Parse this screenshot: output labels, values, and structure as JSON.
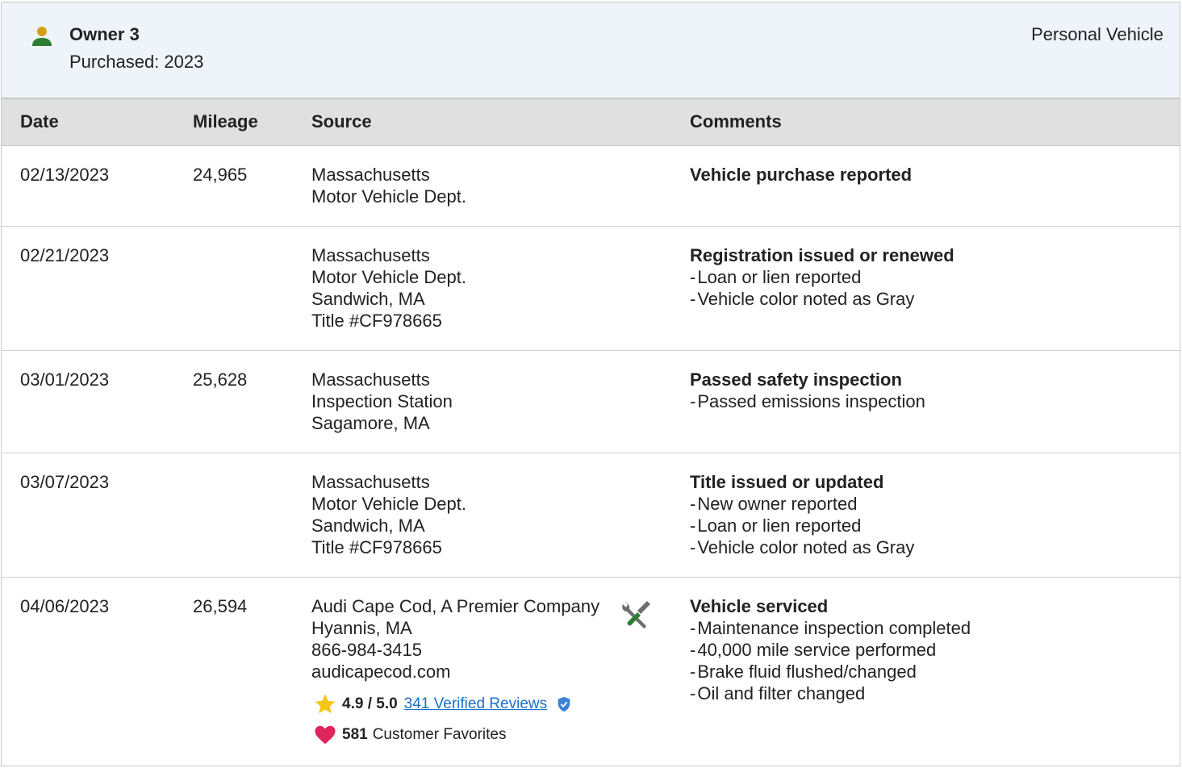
{
  "owner": {
    "title": "Owner 3",
    "purchased": "Purchased: 2023",
    "type": "Personal Vehicle",
    "icon": "person-icon"
  },
  "columns": {
    "date": "Date",
    "mileage": "Mileage",
    "source": "Source",
    "comments": "Comments"
  },
  "records": [
    {
      "date": "02/13/2023",
      "mileage": "24,965",
      "source": [
        "Massachusetts",
        "Motor Vehicle Dept."
      ],
      "comment_title": "Vehicle purchase reported",
      "comment_items": []
    },
    {
      "date": "02/21/2023",
      "mileage": "",
      "source": [
        "Massachusetts",
        "Motor Vehicle Dept.",
        "Sandwich, MA",
        "Title #CF978665"
      ],
      "comment_title": "Registration issued or renewed",
      "comment_items": [
        "Loan or lien reported",
        "Vehicle color noted as Gray"
      ]
    },
    {
      "date": "03/01/2023",
      "mileage": "25,628",
      "source": [
        "Massachusetts",
        "Inspection Station",
        "Sagamore, MA"
      ],
      "comment_title": "Passed safety inspection",
      "comment_items": [
        "Passed emissions inspection"
      ]
    },
    {
      "date": "03/07/2023",
      "mileage": "",
      "source": [
        "Massachusetts",
        "Motor Vehicle Dept.",
        "Sandwich, MA",
        "Title #CF978665"
      ],
      "comment_title": "Title issued or updated",
      "comment_items": [
        "New owner reported",
        "Loan or lien reported",
        "Vehicle color noted as Gray"
      ]
    },
    {
      "date": "04/06/2023",
      "mileage": "26,594",
      "source": [
        "Audi Cape Cod, A Premier Company",
        "Hyannis, MA",
        "866-984-3415",
        "audicapecod.com"
      ],
      "comment_title": "Vehicle serviced",
      "comment_items": [
        "Maintenance inspection completed",
        "40,000 mile service performed",
        "Brake fluid flushed/changed",
        "Oil and filter changed"
      ],
      "service_icon": "wrench-screwdriver-icon",
      "rating": "4.9 / 5.0",
      "reviews_link": "341 Verified Reviews",
      "favorites_count": "581",
      "favorites_label": "Customer Favorites"
    }
  ],
  "colors": {
    "header_bg": "#eef4fa",
    "table_header_bg": "#e0e0e0",
    "link": "#1a6fc9",
    "star": "#f5c518",
    "heart": "#e0245e",
    "verified": "#3b82d6",
    "owner_icon_head": "#d4a017",
    "owner_icon_body": "#2e7d32"
  }
}
